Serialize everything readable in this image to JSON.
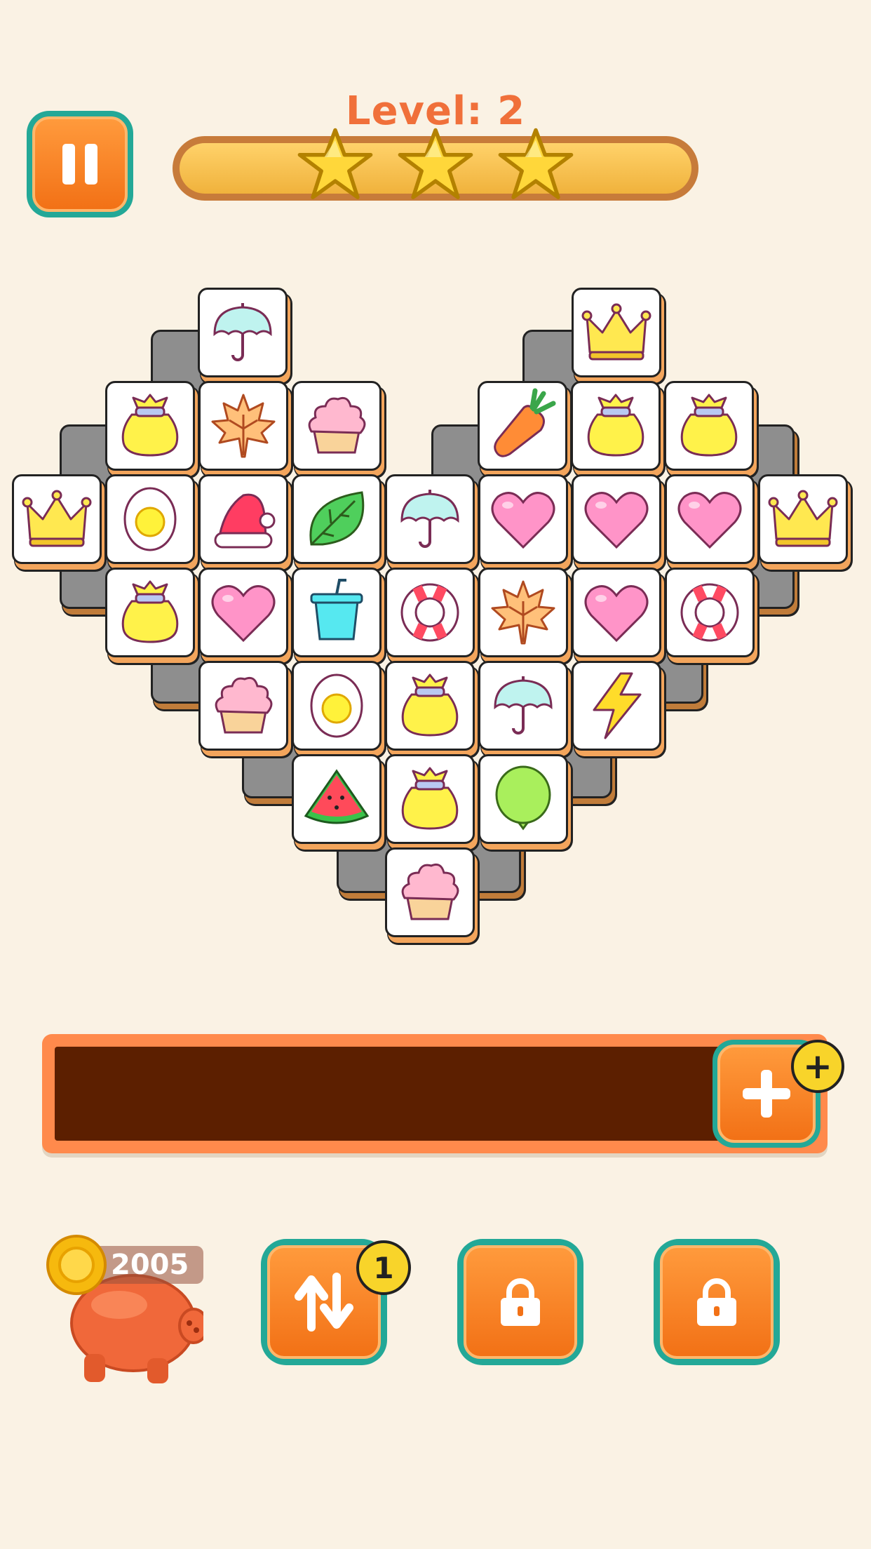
{
  "header": {
    "level_label": "Level: 2",
    "stars_earned": 3,
    "stars_total": 3
  },
  "board": {
    "shape": "heart",
    "tile_icons_top_layer": [
      "umbrella",
      "crown",
      "money-bag",
      "maple-leaf",
      "cupcake",
      "carrot",
      "money-bag",
      "money-bag",
      "crown",
      "egg",
      "santa-hat",
      "leaf",
      "umbrella",
      "heart",
      "heart",
      "heart",
      "crown",
      "money-bag",
      "heart",
      "cup",
      "life-ring",
      "maple-leaf",
      "heart",
      "life-ring",
      "cupcake",
      "egg",
      "money-bag",
      "umbrella",
      "lightning",
      "watermelon",
      "money-bag",
      "balloon",
      "cupcake"
    ]
  },
  "tray": {
    "add_slot_badge": "+"
  },
  "bottom_bar": {
    "coins": "2005",
    "shuffle_count": "1"
  },
  "colors": {
    "background": "#faf2e4",
    "accent_orange": "#f27116",
    "button_teal": "#23a897",
    "tray_dark": "#5c1f00",
    "level_text": "#f0703a"
  }
}
